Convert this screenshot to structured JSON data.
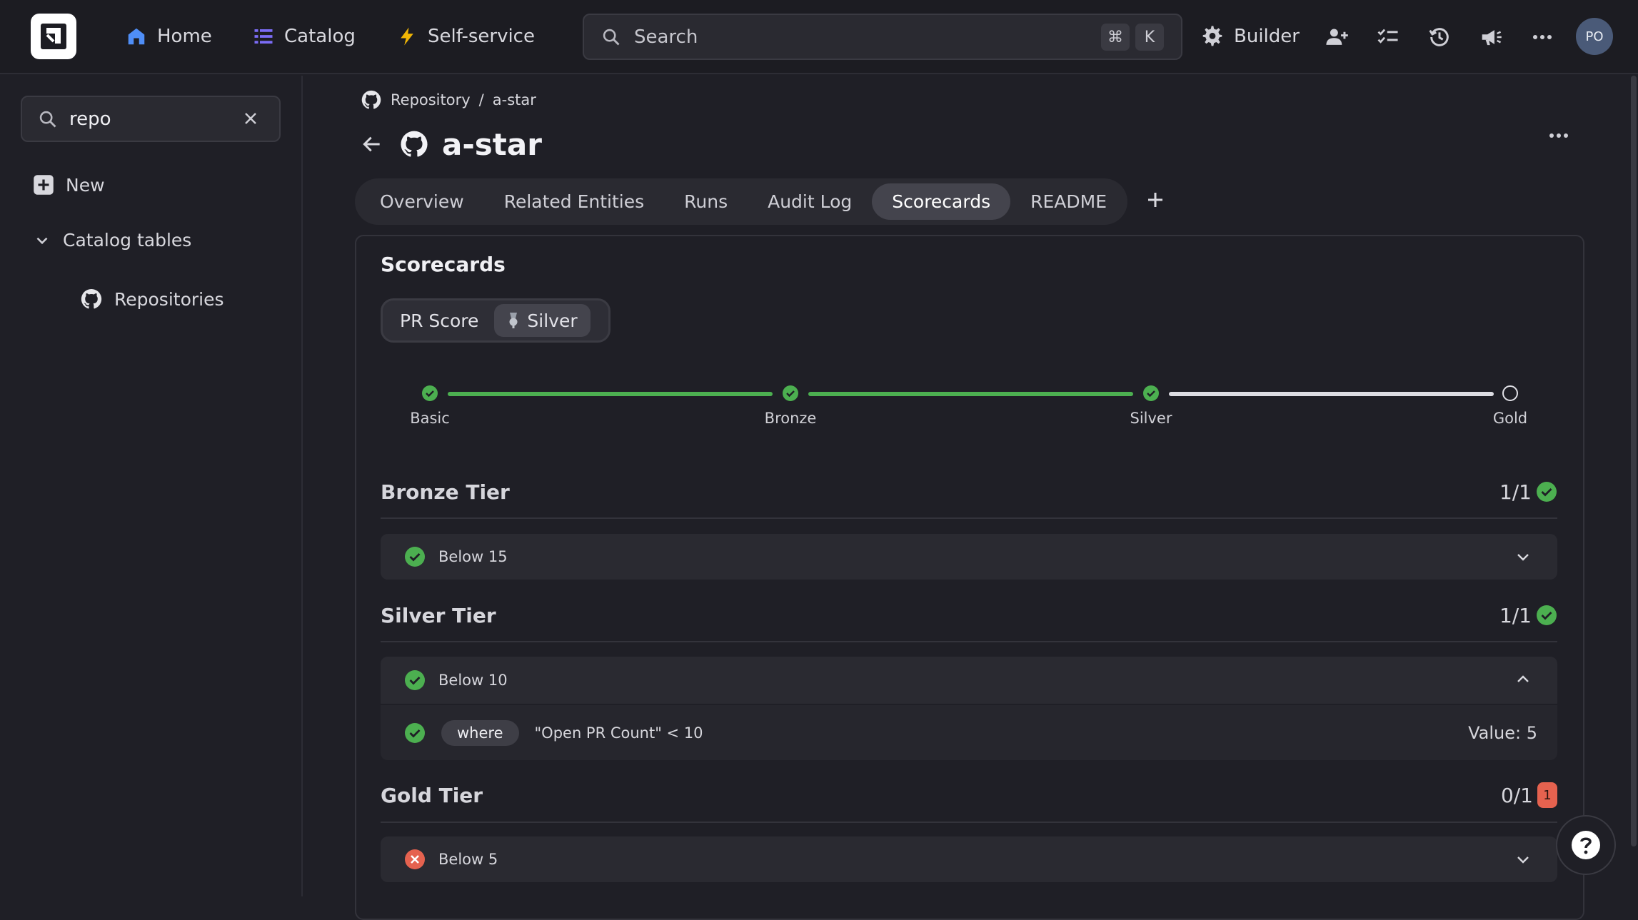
{
  "nav": {
    "home": "Home",
    "catalog": "Catalog",
    "self_service": "Self-service",
    "search_placeholder": "Search",
    "shortcut_cmd": "⌘",
    "shortcut_key": "K",
    "builder": "Builder",
    "avatar_initials": "PO"
  },
  "sidebar": {
    "search_value": "repo",
    "new_label": "New",
    "section_label": "Catalog tables",
    "items": [
      {
        "label": "Repositories",
        "icon": "github-icon"
      }
    ]
  },
  "breadcrumb": {
    "parent": "Repository",
    "separator": "/",
    "current": "a-star"
  },
  "page": {
    "title": "a-star"
  },
  "tabs": [
    "Overview",
    "Related Entities",
    "Runs",
    "Audit Log",
    "Scorecards",
    "README"
  ],
  "active_tab": "Scorecards",
  "scorecards": {
    "title": "Scorecards",
    "segments": {
      "score": "PR Score",
      "level": "Silver"
    },
    "progress": {
      "levels": [
        "Basic",
        "Bronze",
        "Silver",
        "Gold"
      ],
      "completed": [
        true,
        true,
        true,
        false
      ]
    },
    "tiers": [
      {
        "name": "Bronze Tier",
        "score": "1/1",
        "status": "pass",
        "rules": [
          {
            "name": "Below 15",
            "status": "pass",
            "expanded": false
          }
        ]
      },
      {
        "name": "Silver Tier",
        "score": "1/1",
        "status": "pass",
        "rules": [
          {
            "name": "Below 10",
            "status": "pass",
            "expanded": true,
            "condition": {
              "operator_label": "where",
              "expression": "\"Open PR Count\" < 10",
              "value_text": "Value: 5"
            }
          }
        ]
      },
      {
        "name": "Gold Tier",
        "score": "0/1",
        "status": "fail",
        "fail_count": "1",
        "rules": [
          {
            "name": "Below 5",
            "status": "fail",
            "expanded": false
          }
        ]
      }
    ]
  },
  "colors": {
    "pass": "#4caf50",
    "fail": "#e5624f",
    "accent_blue": "#4f8ef7",
    "accent_purple": "#7b6cf6",
    "accent_yellow": "#f2b705"
  }
}
